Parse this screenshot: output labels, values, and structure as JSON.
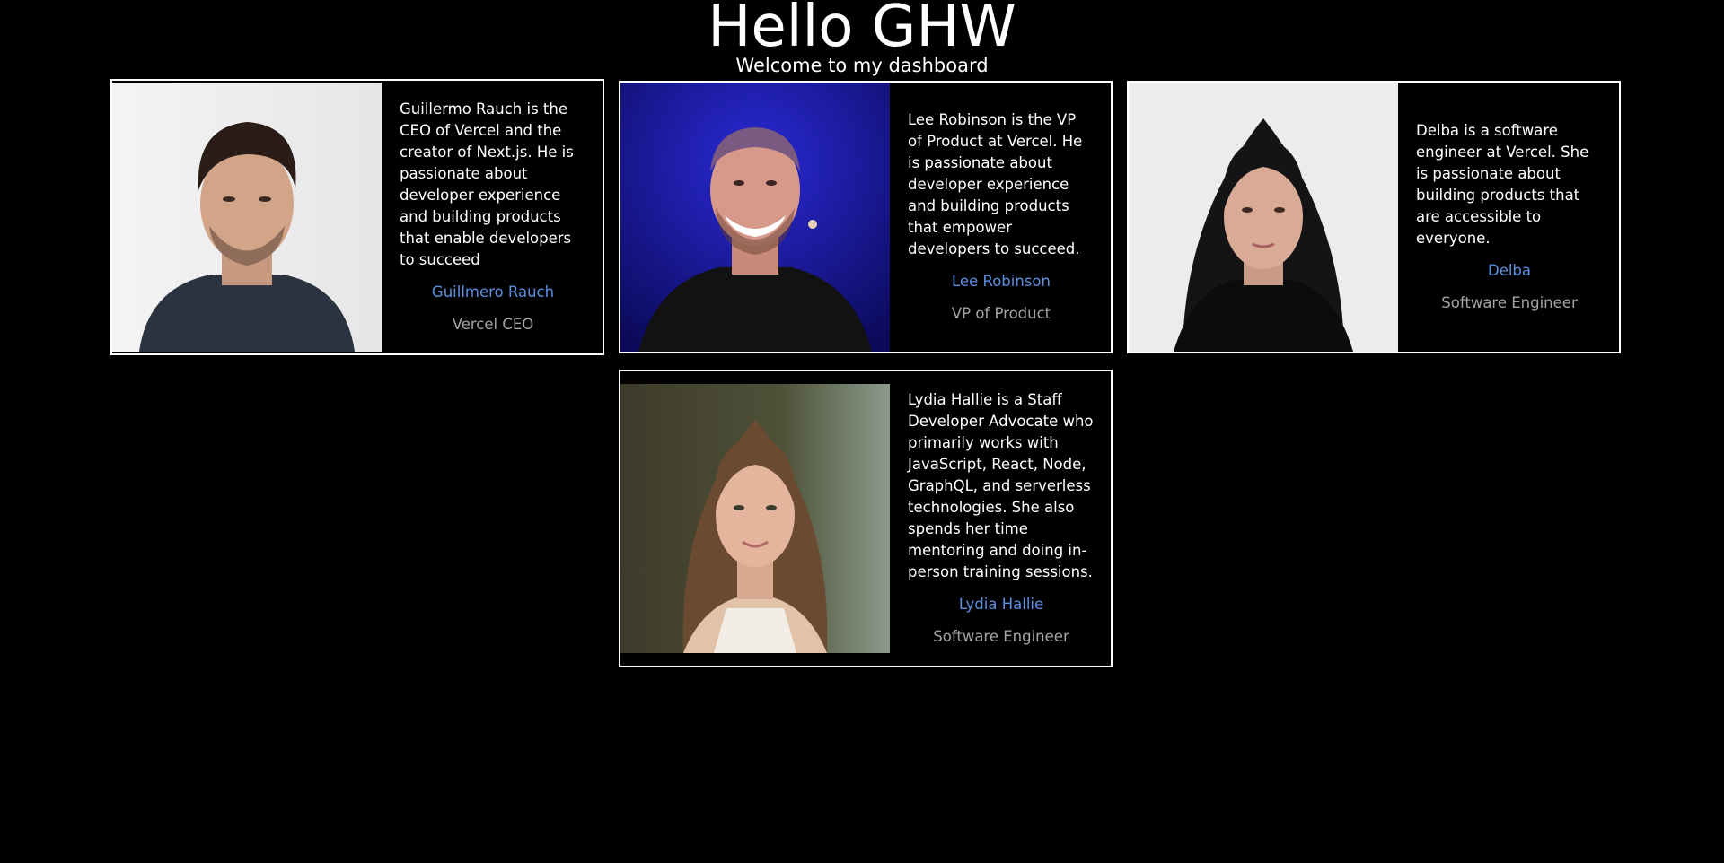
{
  "header": {
    "title": "Hello GHW",
    "subtitle": "Welcome to my dashboard"
  },
  "cards": [
    {
      "bio": "Guillermo Rauch is the CEO of Vercel and the creator of Next.js. He is passionate about developer experience and building products that enable developers to succeed",
      "name": "Guillmero Rauch",
      "role": "Vercel CEO"
    },
    {
      "bio": "Lee Robinson is the VP of Product at Vercel. He is passionate about developer experience and building products that empower developers to succeed.",
      "name": "Lee Robinson",
      "role": "VP of Product"
    },
    {
      "bio": "Delba is a software engineer at Vercel. She is passionate about building products that are accessible to everyone.",
      "name": "Delba",
      "role": "Software Engineer"
    },
    {
      "bio": "Lydia Hallie is a Staff Developer Advocate who primarily works with JavaScript, React, Node, GraphQL, and serverless technologies. She also spends her time mentoring and doing in-person training sessions.",
      "name": "Lydia Hallie",
      "role": "Software Engineer"
    }
  ],
  "colors": {
    "background": "#000000",
    "link": "#5b8fe0",
    "muted": "#a3a3a3",
    "border": "#ffffff"
  }
}
